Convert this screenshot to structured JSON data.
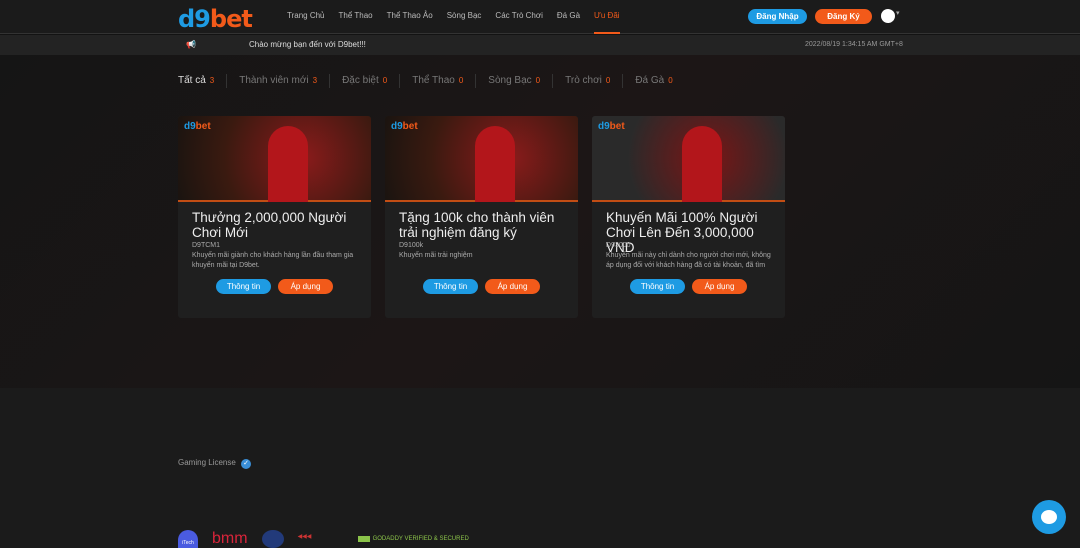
{
  "header": {
    "logo_d9": "d9",
    "logo_bet": "bet",
    "nav": [
      "Trang Chủ",
      "Thể Thao",
      "Thể Thao Ảo",
      "Sòng Bạc",
      "Các Trò Chơi",
      "Đá Gà",
      "Ưu Đãi"
    ],
    "active_nav": "Ưu Đãi",
    "login": "Đăng Nhập",
    "register": "Đăng Ký"
  },
  "ticker": {
    "message": "Chào mừng bạn đến với D9bet!!!",
    "datetime": "2022/08/19 1:34:15 AM GMT+8"
  },
  "tabs": [
    {
      "label": "Tất cả",
      "count": "3"
    },
    {
      "label": "Thành viên mới",
      "count": "3"
    },
    {
      "label": "Đặc biệt",
      "count": "0"
    },
    {
      "label": "Thể Thao",
      "count": "0"
    },
    {
      "label": "Sòng Bạc",
      "count": "0"
    },
    {
      "label": "Trò chơi",
      "count": "0"
    },
    {
      "label": "Đá Gà",
      "count": "0"
    }
  ],
  "promos": [
    {
      "title": "Thưởng 2,000,000 Người Chơi Mới",
      "code": "D9TCM1",
      "desc": "Khuyến mãi giành cho khách hàng lần đầu tham gia khuyến mãi tại D9bet.",
      "info": "Thông tin",
      "apply": "Áp dụng"
    },
    {
      "title": "Tặng 100k cho thành viên trải nghiệm đăng ký",
      "code": "D9100k",
      "desc": "Khuyến mãi trải nghiệm",
      "info": "Thông tin",
      "apply": "Áp dụng"
    },
    {
      "title": "Khuyến Mãi 100% Người Chơi Lên Đến 3,000,000 VND",
      "code": "D93000",
      "desc": "Khuyến mãi này chỉ dành cho người chơi mới, không áp dụng đối với khách hàng đã có tài khoản, đã tìm",
      "info": "Thông tin",
      "apply": "Áp dụng"
    }
  ],
  "footer": {
    "license": "Gaming License",
    "partners": [
      "iTech",
      "bmm",
      "GODADDY VERIFIED & SECURED"
    ]
  },
  "colors": {
    "brand_blue": "#1e9be3",
    "brand_orange": "#f25a1a"
  }
}
